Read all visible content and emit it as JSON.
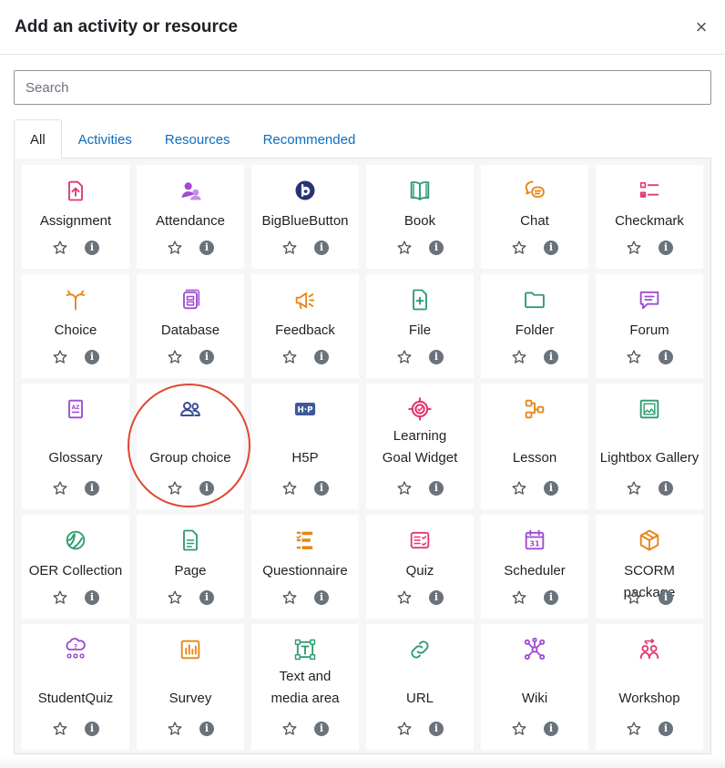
{
  "modal": {
    "title": "Add an activity or resource",
    "close": "×"
  },
  "search": {
    "placeholder": "Search"
  },
  "tabs": [
    {
      "label": "All",
      "active": true
    },
    {
      "label": "Activities",
      "active": false
    },
    {
      "label": "Resources",
      "active": false
    },
    {
      "label": "Recommended",
      "active": false
    }
  ],
  "colors": {
    "assessment": "#e3386f",
    "collaboration": "#9e4cd1",
    "communication": "#e68618",
    "content": "#2e9b6f",
    "interactive": "#6d3c9f",
    "accent": "#0f6cbf",
    "highlight": "#e0472f"
  },
  "items": [
    {
      "label": "Assignment",
      "icon": "assignment-icon"
    },
    {
      "label": "Attendance",
      "icon": "attendance-icon"
    },
    {
      "label": "BigBlueButton",
      "icon": "bigbluebutton-icon"
    },
    {
      "label": "Book",
      "icon": "book-icon"
    },
    {
      "label": "Chat",
      "icon": "chat-icon"
    },
    {
      "label": "Checkmark",
      "icon": "checkmark-icon"
    },
    {
      "label": "Choice",
      "icon": "choice-icon"
    },
    {
      "label": "Database",
      "icon": "database-icon"
    },
    {
      "label": "Feedback",
      "icon": "feedback-icon"
    },
    {
      "label": "File",
      "icon": "file-icon"
    },
    {
      "label": "Folder",
      "icon": "folder-icon"
    },
    {
      "label": "Forum",
      "icon": "forum-icon"
    },
    {
      "label": "Glossary",
      "icon": "glossary-icon"
    },
    {
      "label": "Group choice",
      "icon": "group-choice-icon"
    },
    {
      "label": "H5P",
      "icon": "h5p-icon"
    },
    {
      "label": "Learning Goal Widget",
      "icon": "learning-goal-icon"
    },
    {
      "label": "Lesson",
      "icon": "lesson-icon"
    },
    {
      "label": "Lightbox Gallery",
      "icon": "lightbox-gallery-icon"
    },
    {
      "label": "OER Collection",
      "icon": "oer-collection-icon"
    },
    {
      "label": "Page",
      "icon": "page-icon"
    },
    {
      "label": "Questionnaire",
      "icon": "questionnaire-icon"
    },
    {
      "label": "Quiz",
      "icon": "quiz-icon"
    },
    {
      "label": "Scheduler",
      "icon": "scheduler-icon"
    },
    {
      "label": "SCORM package",
      "icon": "scorm-package-icon"
    },
    {
      "label": "StudentQuiz",
      "icon": "studentquiz-icon"
    },
    {
      "label": "Survey",
      "icon": "survey-icon"
    },
    {
      "label": "Text and media area",
      "icon": "text-media-icon"
    },
    {
      "label": "URL",
      "icon": "url-icon"
    },
    {
      "label": "Wiki",
      "icon": "wiki-icon"
    },
    {
      "label": "Workshop",
      "icon": "workshop-icon"
    }
  ],
  "actions": {
    "star_icon": "star-icon",
    "info_icon": "info-icon",
    "info_glyph": "i"
  }
}
